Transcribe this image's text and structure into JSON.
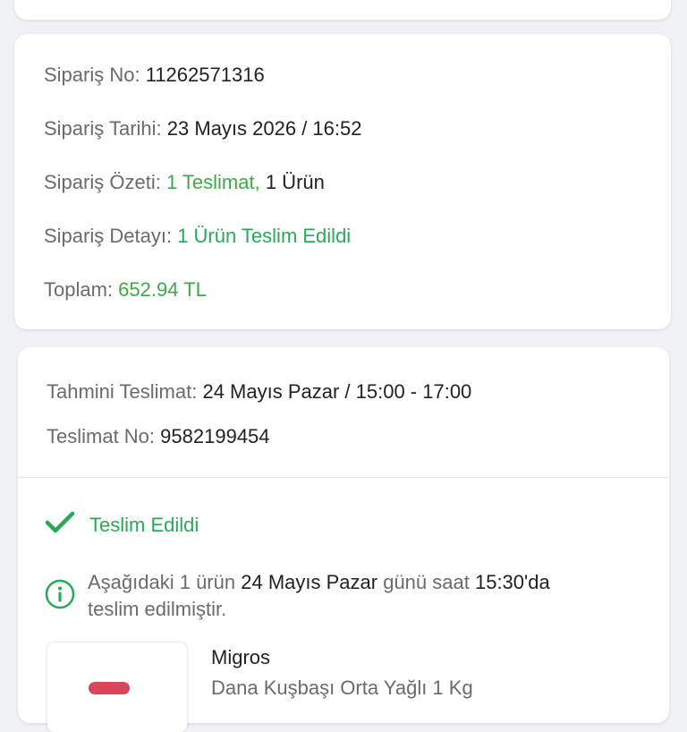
{
  "order": {
    "number_label": "Sipariş No:",
    "number_value": "11262571316",
    "date_label": "Sipariş Tarihi:",
    "date_value": "23 Mayıs 2026 / 16:52",
    "summary_label": "Sipariş Özeti:",
    "summary_deliveries": "1 Teslimat,",
    "summary_items": "1 Ürün",
    "detail_label": "Sipariş Detayı:",
    "detail_value": "1 Ürün Teslim Edildi",
    "total_label": "Toplam:",
    "total_value": "652.94 TL"
  },
  "delivery": {
    "estimated_label": "Tahmini Teslimat:",
    "estimated_value": "24 Mayıs Pazar / 15:00 - 17:00",
    "number_label": "Teslimat No:",
    "number_value": "9582199454",
    "status": "Teslim Edildi",
    "info_prefix": "Aşağıdaki 1 ürün",
    "info_day": "24 Mayıs Pazar",
    "info_mid": "günü saat",
    "info_time": "15:30'da",
    "info_suffix": "teslim edilmiştir."
  },
  "product": {
    "store": "Migros",
    "name": "Dana Kuşbaşı Orta Yağlı 1 Kg"
  },
  "colors": {
    "accent_green": "#3fa84a",
    "status_green": "#2aa85a"
  },
  "icons": {
    "status": "check-icon",
    "info": "info-circle-icon"
  }
}
